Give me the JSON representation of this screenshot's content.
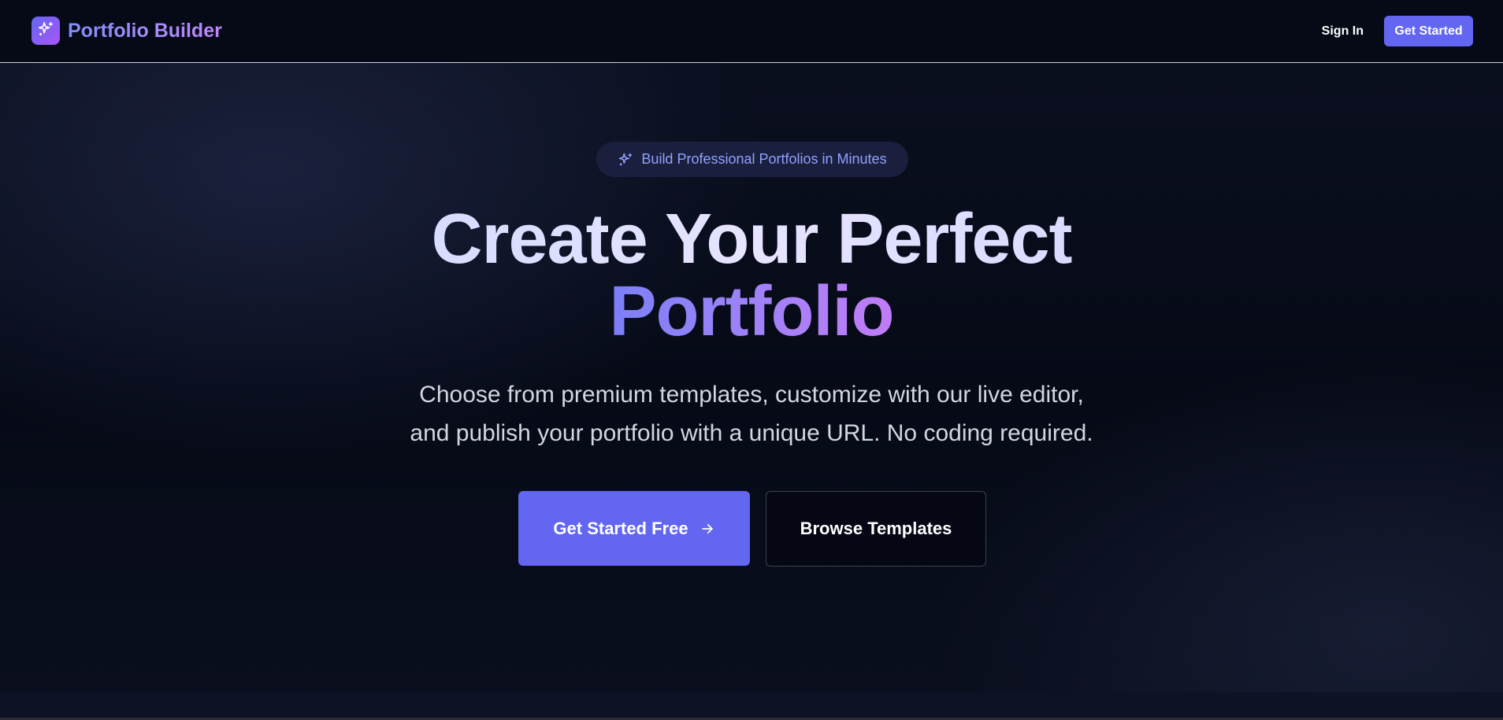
{
  "header": {
    "brand_name": "Portfolio Builder",
    "brand_icon": "sparkles-icon",
    "sign_in_label": "Sign In",
    "get_started_label": "Get Started"
  },
  "hero": {
    "badge_icon": "sparkles-icon",
    "badge_text": "Build Professional Portfolios in Minutes",
    "title_line1": "Create Your Perfect",
    "title_line2": "Portfolio",
    "subtitle_line1": "Choose from premium templates, customize with our live editor,",
    "subtitle_line2": "and publish your portfolio with a unique URL. No coding required.",
    "primary_cta_label": "Get Started Free",
    "primary_cta_icon": "arrow-right-icon",
    "secondary_cta_label": "Browse Templates"
  },
  "colors": {
    "background": "#060a17",
    "accent": "#6366f1",
    "accent_purple": "#a855f7",
    "badge_bg": "#1b1f3e",
    "badge_text": "#8ea2ff"
  }
}
